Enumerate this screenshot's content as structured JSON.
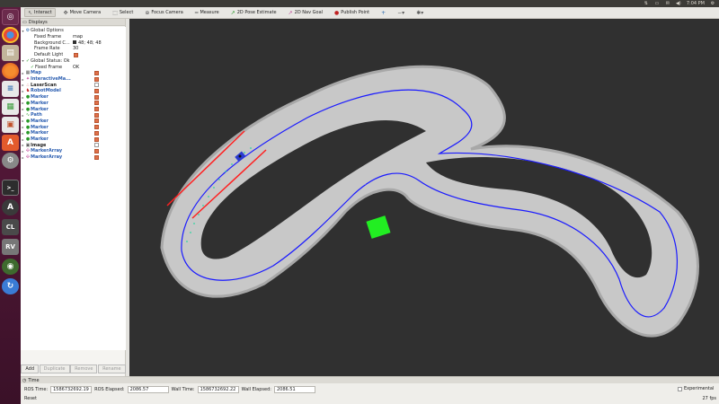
{
  "topbar": {
    "clock": "7:04 PM"
  },
  "toolbar": {
    "tools": [
      {
        "label": "Interact",
        "icon": "cursor-icon"
      },
      {
        "label": "Move Camera",
        "icon": "move-camera-icon"
      },
      {
        "label": "Select",
        "icon": "select-icon"
      },
      {
        "label": "Focus Camera",
        "icon": "focus-camera-icon"
      },
      {
        "label": "Measure",
        "icon": "measure-icon"
      },
      {
        "label": "2D Pose Estimate",
        "icon": "pose-estimate-icon"
      },
      {
        "label": "2D Nav Goal",
        "icon": "nav-goal-icon"
      },
      {
        "label": "Publish Point",
        "icon": "publish-point-icon"
      }
    ]
  },
  "displays": {
    "title": "Displays",
    "global_options": "Global Options",
    "fixed_frame_label": "Fixed Frame",
    "fixed_frame_value": "map",
    "background_label": "Background C...",
    "background_value": "48; 48; 48",
    "frame_rate_label": "Frame Rate",
    "frame_rate_value": "30",
    "default_light_label": "Default Light",
    "global_status": "Global Status: Ok",
    "status_fixed_frame": "Fixed Frame",
    "status_ok": "OK",
    "items": [
      {
        "name": "Map",
        "icon": "map-icon",
        "checked": true
      },
      {
        "name": "InteractiveMa...",
        "icon": "interactive-marker-icon",
        "checked": true
      },
      {
        "name": "LaserScan",
        "icon": "laserscan-icon",
        "checked": false
      },
      {
        "name": "RobotModel",
        "icon": "robot-model-icon",
        "checked": true
      },
      {
        "name": "Marker",
        "icon": "marker-icon",
        "checked": true
      },
      {
        "name": "Marker",
        "icon": "marker-icon",
        "checked": true
      },
      {
        "name": "Marker",
        "icon": "marker-icon",
        "checked": true
      },
      {
        "name": "Path",
        "icon": "path-icon",
        "checked": true
      },
      {
        "name": "Marker",
        "icon": "marker-icon",
        "checked": true
      },
      {
        "name": "Marker",
        "icon": "marker-icon",
        "checked": true
      },
      {
        "name": "Marker",
        "icon": "marker-icon",
        "checked": true
      },
      {
        "name": "Marker",
        "icon": "marker-icon",
        "checked": true
      },
      {
        "name": "Image",
        "icon": "image-icon",
        "checked": false
      },
      {
        "name": "MarkerArray",
        "icon": "marker-array-icon",
        "checked": true
      },
      {
        "name": "MarkerArray",
        "icon": "marker-array-icon",
        "checked": true
      }
    ],
    "buttons": {
      "add": "Add",
      "duplicate": "Duplicate",
      "remove": "Remove",
      "rename": "Rename"
    }
  },
  "viewport": {
    "background": "#303030",
    "track_color": "#c8c8c8",
    "centerline_color": "#1a1aff",
    "bound_color": "#ff2020",
    "goal_color": "#22ee22"
  },
  "time": {
    "title": "Time",
    "ros_time_label": "ROS Time:",
    "ros_time": "1586732692.19",
    "ros_elapsed_label": "ROS Elapsed:",
    "ros_elapsed": "2086.57",
    "wall_time_label": "Wall Time:",
    "wall_time": "1586732692.22",
    "wall_elapsed_label": "Wall Elapsed:",
    "wall_elapsed": "2086.51",
    "experimental": "Experimental",
    "reset": "Reset",
    "fps": "27 fps"
  }
}
